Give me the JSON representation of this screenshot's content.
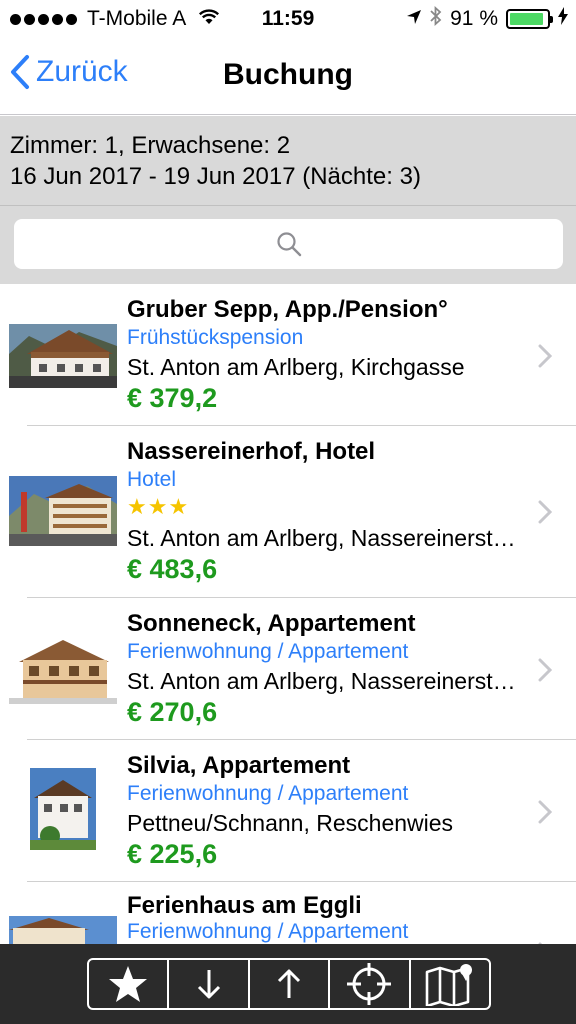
{
  "status_bar": {
    "carrier": "T-Mobile A",
    "time": "11:59",
    "battery_text": "91 %",
    "battery_level": 0.91,
    "icons": [
      "signal-dots-icon",
      "wifi-icon",
      "location-icon",
      "bluetooth-icon",
      "battery-icon",
      "charging-icon"
    ]
  },
  "nav": {
    "back_label": "Zurück",
    "title": "Buchung"
  },
  "info": {
    "line1": "Zimmer: 1, Erwachsene: 2",
    "line2": "16 Jun 2017 - 19 Jun 2017 (Nächte: 3)"
  },
  "search": {
    "placeholder": "",
    "icon": "search-icon"
  },
  "listings": [
    {
      "name": "Gruber Sepp, App./Pension°",
      "type": "Frühstückspension",
      "stars": "",
      "address": "St. Anton am Arlberg, Kirchgasse",
      "price": "€ 379,2"
    },
    {
      "name": "Nassereinerhof, Hotel",
      "type": "Hotel",
      "stars": "★★★",
      "address": "St. Anton am Arlberg, Nassereinerstraße",
      "price": "€ 483,6"
    },
    {
      "name": "Sonneneck, Appartement",
      "type": "Ferienwohnung / Appartement",
      "stars": "",
      "address": "St. Anton am Arlberg, Nassereinerstraße",
      "price": "€ 270,6"
    },
    {
      "name": "Silvia, Appartement",
      "type": "Ferienwohnung / Appartement",
      "stars": "",
      "address": "Pettneu/Schnann, Reschenwies",
      "price": "€ 225,6"
    },
    {
      "name": "Ferienhaus am Eggli",
      "type": "Ferienwohnung / Appartement",
      "stars": "",
      "address": "",
      "price": ""
    }
  ],
  "toolbar": {
    "buttons": [
      "star-icon",
      "arrow-down-icon",
      "arrow-up-icon",
      "crosshair-icon",
      "map-icon"
    ]
  },
  "colors": {
    "accent": "#2d7ff9",
    "price": "#1e9a1e",
    "star": "#f5c400",
    "header_bg": "#d9d9d9",
    "toolbar_bg": "#2b2b2b"
  }
}
